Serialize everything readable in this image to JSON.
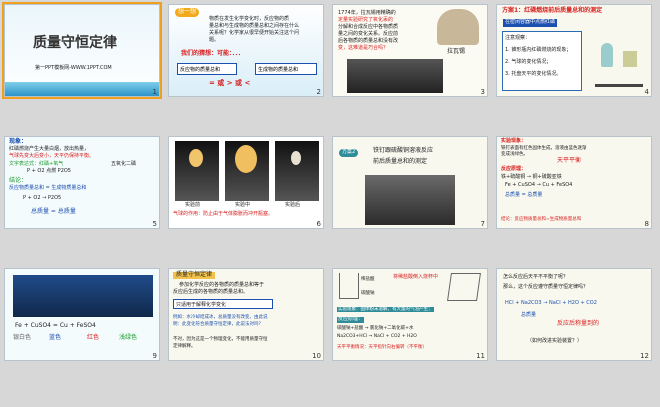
{
  "slides": [
    {
      "n": "1",
      "title": "质量守恒定律",
      "footer": "第一PPT模板网-WWW.1PPT.COM"
    },
    {
      "n": "2",
      "badge": "想一想",
      "text1": "物质在发生化学变化时，反应物的质",
      "text2": "量总和与生成物的质量总和之间存在什么",
      "text3": "关系呢？化学家从很早便开始关注这个问",
      "text4": "题。",
      "guess": "我们的猜想：可能：．．．",
      "q1": "反应物的质量总和",
      "q2": "生成物的质量总和",
      "eq": "= 或 > 或 <"
    },
    {
      "n": "3",
      "text1": "1774年，拉瓦锡用精确的",
      "text2": "定量实验研究了氧化汞的",
      "text3": "分解和合成反应中各物质质",
      "text4": "量之间的变化关系。反应前",
      "text5": "后各物质的质量总和没有改",
      "text6": "变，这难道是巧合吗？",
      "name": "拉瓦锡"
    },
    {
      "n": "4",
      "plan": "方案1：红磷燃烧前后质量总和的测定",
      "sub": "在密闭容器中点燃红磷",
      "notes": "注意观察：",
      "items": [
        "1. 锥形瓶内红磷燃烧的现象；",
        "2. 气球的变化情况；",
        "3. 托盘天平的变化情况。"
      ]
    },
    {
      "n": "5",
      "h": "现象：",
      "l1": "红磷燃烧产生大量白烟，放出热量，",
      "l2": "气球先变大后变小，天平仍保持平衡。",
      "l3": "文字表达式：红磷+氧气",
      "l3b": "五氧化二磷",
      "l4": "P + O2 点燃 P2O5",
      "l5": "结论：",
      "l6": "反应物质量总和 = 生成物质量总和",
      "l7": "P + O2 → P2O5",
      "l8": "总质量 = 总质量"
    },
    {
      "n": "6",
      "labels": [
        "实验前",
        "实验中",
        "实验后"
      ],
      "note": "气球的作用：防止由于气体膨胀而冲开瓶塞。"
    },
    {
      "n": "7",
      "plan": "方案2",
      "t1": "铁钉跟硫酸铜溶液反应",
      "t2": "前后质量总和的测定"
    },
    {
      "n": "8",
      "h1": "实验现象：",
      "l1": "铁钉表面有红色固体生成，溶液由蓝色逐渐",
      "l2": "变成浅绿色。",
      "l3": "天平平衡",
      "h2": "反应原理：",
      "l4": "铁+硫酸铜 → 铜+硫酸亚铁",
      "l5": "Fe + CuSO4 → Cu + FeSO4",
      "l6": "总质量 = 总质量",
      "l7": "结论：反应物质量总和=生成物质量总和"
    },
    {
      "n": "9",
      "eq": "Fe + CuSO4 = Cu + FeSO4",
      "colors": [
        "银白色",
        "蓝色",
        "红色",
        "浅绿色"
      ]
    },
    {
      "n": "10",
      "h": "质量守恒定律",
      "l1": "参加化学反应的各物质的质量总和等于",
      "l2": "反应后生成的各物质的质量总和。",
      "l3": "只适用于解释化学变化",
      "l4": "例如：水冷却结成冰，总质量没有改变，由此说",
      "l5": "明：此变化符合质量守恒定律，此说法对吗？",
      "l6": "不对，因为这是一个物理变化，不能用质量守恒",
      "l7": "定律解释。"
    },
    {
      "n": "11",
      "lab1": "稀盐酸",
      "lab2": "碳酸钠",
      "tip": "将稀盐酸倒入烧杯中",
      "h1": "实验现象：固体粉末溶解，有大量的气泡产生；",
      "h2": "反应原理：",
      "l1": "碳酸钠+盐酸 → 氯化钠+二氧化碳+水",
      "l2": "Na2CO3+HCl → NaCl + CO2 + H2O",
      "l3": "天平平衡情况：天平指针向右偏转（不平衡）"
    },
    {
      "n": "12",
      "q1": "怎么反应后天平不平衡了呢？",
      "q2": "那么，这个反应遵守质量守恒定律吗？",
      "eq": "HCl + Na2CO3 → NaCl + H2O + CO2",
      "m": "总质量",
      "ans": "反应后称量到的",
      "q3": "（如何改进实验装置？）"
    }
  ]
}
